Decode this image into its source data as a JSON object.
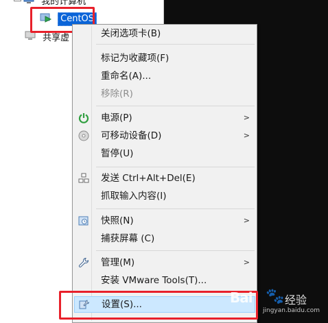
{
  "tree": {
    "my_computer": "我的计算机",
    "vm_name": "CentOS",
    "shared": "共享虚"
  },
  "menu": {
    "items": [
      {
        "label": "关闭选项卡(B)",
        "icon": "none",
        "submenu": false,
        "disabled": false
      },
      {
        "label": "标记为收藏项(F)",
        "icon": "none",
        "submenu": false,
        "disabled": false
      },
      {
        "label": "重命名(A)...",
        "icon": "none",
        "submenu": false,
        "disabled": false
      },
      {
        "label": "移除(R)",
        "icon": "none",
        "submenu": false,
        "disabled": true
      },
      {
        "label": "电源(P)",
        "icon": "power-icon",
        "submenu": true,
        "disabled": false
      },
      {
        "label": "可移动设备(D)",
        "icon": "removable-device-icon",
        "submenu": true,
        "disabled": false
      },
      {
        "label": "暂停(U)",
        "icon": "none",
        "submenu": false,
        "disabled": false
      },
      {
        "label": "发送 Ctrl+Alt+Del(E)",
        "icon": "send-keys-icon",
        "submenu": false,
        "disabled": false
      },
      {
        "label": "抓取输入内容(I)",
        "icon": "none",
        "submenu": false,
        "disabled": false
      },
      {
        "label": "快照(N)",
        "icon": "snapshot-icon",
        "submenu": true,
        "disabled": false
      },
      {
        "label": "捕获屏幕 (C)",
        "icon": "none",
        "submenu": false,
        "disabled": false
      },
      {
        "label": "管理(M)",
        "icon": "wrench-icon",
        "submenu": true,
        "disabled": false
      },
      {
        "label": "安装 VMware Tools(T)...",
        "icon": "none",
        "submenu": false,
        "disabled": false
      },
      {
        "label": "设置(S)...",
        "icon": "settings-icon",
        "submenu": false,
        "disabled": false,
        "selected": true
      }
    ]
  },
  "watermark": {
    "logo": "Bai",
    "text": "经验",
    "url": "jingyan.baidu.com"
  },
  "colors": {
    "accent_red": "#e8202a",
    "selection_blue": "#0a64d8",
    "menu_hover": "#cce8ff"
  }
}
